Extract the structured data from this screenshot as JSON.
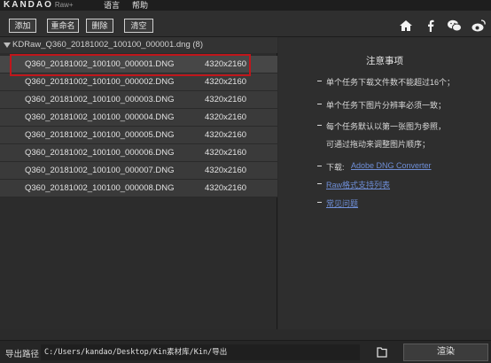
{
  "titlebar": {
    "logo": "KANDAO",
    "logo_suffix": "Raw+",
    "menu": [
      "语言",
      "帮助"
    ]
  },
  "toolbar": {
    "buttons": [
      "添加",
      "重命名",
      "删除",
      "清空"
    ],
    "icons": [
      "home-icon",
      "facebook-icon",
      "wechat-icon",
      "weibo-icon"
    ]
  },
  "file_group": {
    "name": "KDRaw_Q360_20181002_100100_000001.dng",
    "count": "(8)",
    "files": [
      {
        "name": "Q360_20181002_100100_000001.DNG",
        "resolution": "4320x2160"
      },
      {
        "name": "Q360_20181002_100100_000002.DNG",
        "resolution": "4320x2160"
      },
      {
        "name": "Q360_20181002_100100_000003.DNG",
        "resolution": "4320x2160"
      },
      {
        "name": "Q360_20181002_100100_000004.DNG",
        "resolution": "4320x2160"
      },
      {
        "name": "Q360_20181002_100100_000005.DNG",
        "resolution": "4320x2160"
      },
      {
        "name": "Q360_20181002_100100_000006.DNG",
        "resolution": "4320x2160"
      },
      {
        "name": "Q360_20181002_100100_000007.DNG",
        "resolution": "4320x2160"
      },
      {
        "name": "Q360_20181002_100100_000008.DNG",
        "resolution": "4320x2160"
      }
    ]
  },
  "notes": {
    "title": "注意事项",
    "items": [
      "单个任务下载文件数不能超过16个；",
      "单个任务下图片分辨率必须一致；",
      "每个任务默认以第一张图为参照，",
      "可通过拖动来调整图片顺序；"
    ],
    "download_label": "下载:",
    "download_link": "Adobe DNG Converter",
    "format_link": "Raw格式支持列表",
    "faq_link": "常见问题"
  },
  "bottom": {
    "export_label": "导出路径",
    "export_path": "C:/Users/kandao/Desktop/Kin素材库/Kin/导出",
    "render_button": "渲染"
  },
  "colors": {
    "highlight_border": "#c0161b",
    "link": "#6f8fd8",
    "background": "#2b2b2b"
  }
}
